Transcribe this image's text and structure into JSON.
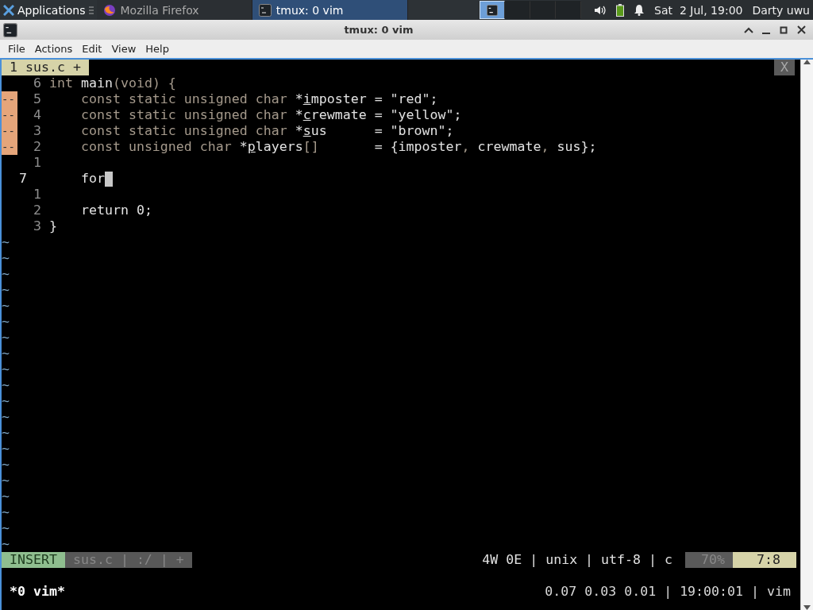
{
  "panel": {
    "apps_label": "Applications",
    "tasks": [
      {
        "title": "Mozilla Firefox",
        "kind": "browser",
        "selected": false
      },
      {
        "title": "tmux: 0 vim",
        "kind": "terminal",
        "selected": true
      }
    ],
    "workspaces": [
      {
        "selected": true
      },
      {
        "selected": false
      },
      {
        "selected": false
      },
      {
        "selected": false
      }
    ],
    "clock": "Sat  2 Jul, 19:00",
    "user": "Darty uwu"
  },
  "window": {
    "title": "tmux: 0 vim"
  },
  "menu": [
    "File",
    "Actions",
    "Edit",
    "View",
    "Help"
  ],
  "vim": {
    "tab": "1 sus.c +",
    "close_tab": "X",
    "code_lines": [
      {
        "number": "6",
        "current": false,
        "cursor": false,
        "segments": [
          {
            "kind": "keyword",
            "text": "int "
          },
          {
            "kind": "plain",
            "text": "main"
          },
          {
            "kind": "keyword",
            "text": "(void) {"
          }
        ]
      },
      {
        "sign": "--",
        "number": "5",
        "current": false,
        "cursor": false,
        "segments": [
          {
            "kind": "keyword",
            "text": "    const static unsigned char "
          },
          {
            "kind": "plain",
            "text": "*"
          },
          {
            "kind": "mark",
            "text": "i"
          },
          {
            "kind": "plain",
            "text": "mposter = \"red\";"
          }
        ]
      },
      {
        "sign": "--",
        "number": "4",
        "current": false,
        "cursor": false,
        "segments": [
          {
            "kind": "keyword",
            "text": "    const static unsigned char "
          },
          {
            "kind": "plain",
            "text": "*"
          },
          {
            "kind": "mark",
            "text": "c"
          },
          {
            "kind": "plain",
            "text": "rewmate = \"yellow\";"
          }
        ]
      },
      {
        "sign": "--",
        "number": "3",
        "current": false,
        "cursor": false,
        "segments": [
          {
            "kind": "keyword",
            "text": "    const static unsigned char "
          },
          {
            "kind": "plain",
            "text": "*"
          },
          {
            "kind": "mark",
            "text": "s"
          },
          {
            "kind": "plain",
            "text": "us      = \"brown\";"
          }
        ]
      },
      {
        "sign": "--",
        "number": "2",
        "current": false,
        "cursor": false,
        "segments": [
          {
            "kind": "keyword",
            "text": "    const unsigned char "
          },
          {
            "kind": "plain",
            "text": "*"
          },
          {
            "kind": "mark",
            "text": "p"
          },
          {
            "kind": "plain",
            "text": "layers"
          },
          {
            "kind": "keyword",
            "text": "[]"
          },
          {
            "kind": "plain",
            "text": "       = {imposter"
          },
          {
            "kind": "keyword",
            "text": ", "
          },
          {
            "kind": "plain",
            "text": "crewmate"
          },
          {
            "kind": "keyword",
            "text": ", "
          },
          {
            "kind": "plain",
            "text": "sus};"
          }
        ]
      },
      {
        "number": "1",
        "current": false,
        "cursor": false
      },
      {
        "number": "7",
        "current": true,
        "cursor": true,
        "segments": [
          {
            "kind": "plain",
            "text": "    for"
          }
        ]
      },
      {
        "number": "1",
        "current": false,
        "cursor": false
      },
      {
        "number": "2",
        "current": false,
        "cursor": false,
        "segments": [
          {
            "kind": "plain",
            "text": "    return 0;"
          }
        ]
      },
      {
        "number": "3",
        "current": false,
        "cursor": false,
        "segments": [
          {
            "kind": "plain",
            "text": "}"
          }
        ]
      }
    ],
    "filler_lines": [
      "~",
      "~",
      "~",
      "~",
      "~",
      "~",
      "~",
      "~",
      "~",
      "~",
      "~",
      "~",
      "~",
      "~",
      "~",
      "~",
      "~",
      "~",
      "~",
      "~"
    ],
    "status": {
      "mode": "INSERT",
      "file_info": "sus.c | :/ | +",
      "file_details": "4W 0E | unix | utf-8 | c",
      "percent": "70%",
      "position": "7:8"
    }
  },
  "tmux": {
    "window": "*0 vim*",
    "info": "0.07 0.03 0.01 | 19:00:01 | vim"
  }
}
